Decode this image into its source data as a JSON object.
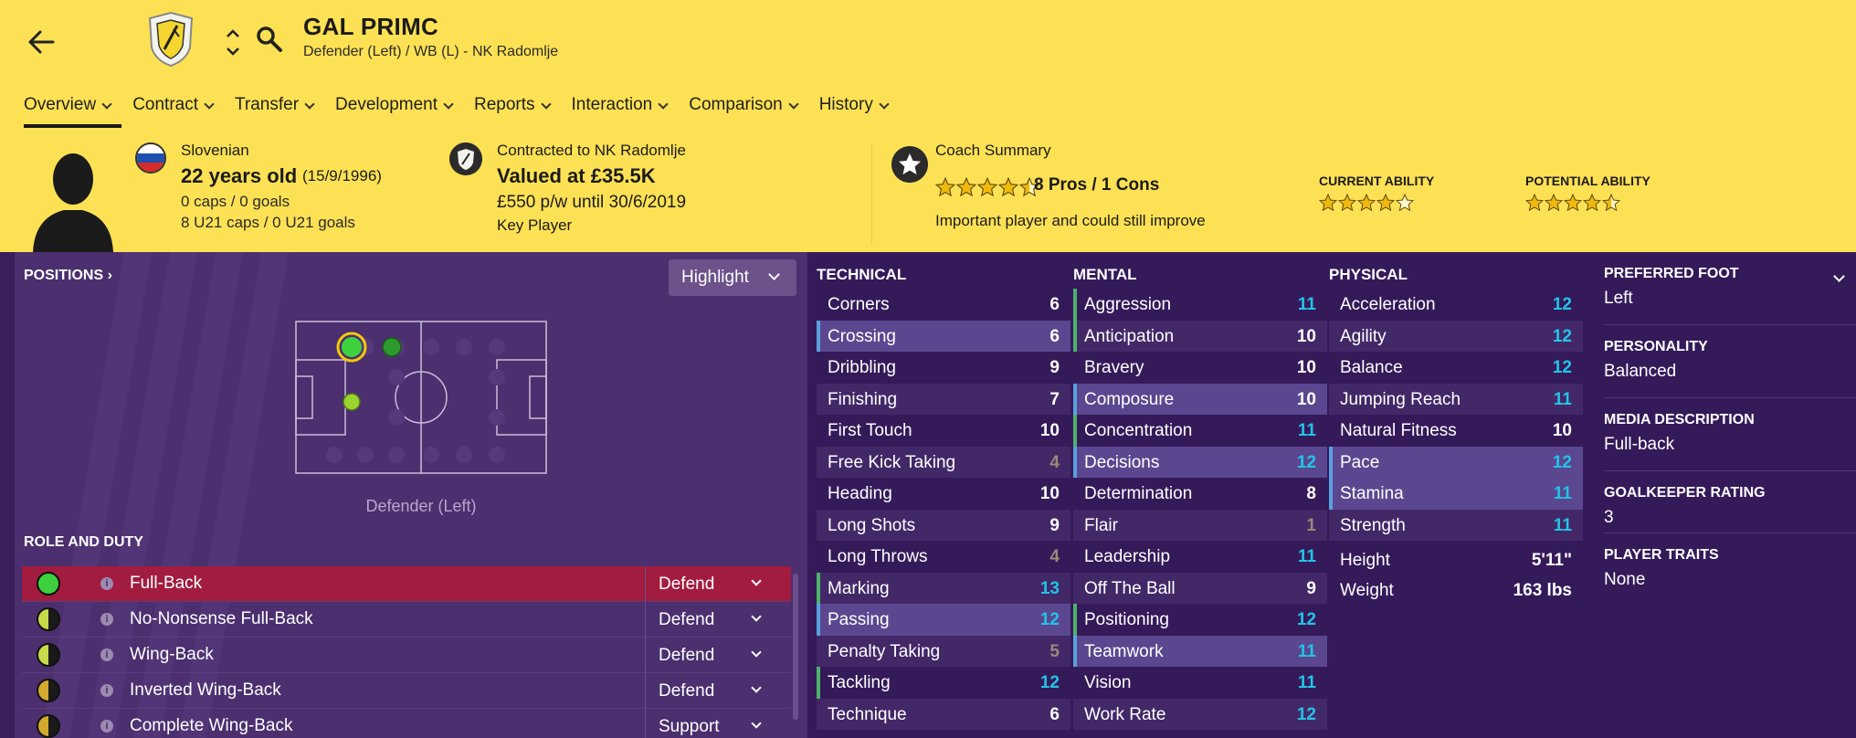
{
  "header": {
    "name": "GAL PRIMC",
    "subtitle": "Defender (Left) / WB (L) - NK Radomlje"
  },
  "tabs": [
    {
      "label": "Overview"
    },
    {
      "label": "Contract"
    },
    {
      "label": "Transfer"
    },
    {
      "label": "Development"
    },
    {
      "label": "Reports"
    },
    {
      "label": "Interaction"
    },
    {
      "label": "Comparison"
    },
    {
      "label": "History"
    }
  ],
  "profile": {
    "nationality": "Slovenian",
    "age": "22 years old",
    "dob": "(15/9/1996)",
    "caps": "0 caps / 0 goals",
    "u21": "8 U21 caps / 0 U21 goals"
  },
  "contract": {
    "club_line": "Contracted to NK Radomlje",
    "value": "Valued at £35.5K",
    "wage": "£550 p/w until 30/6/2019",
    "status": "Key Player"
  },
  "coach": {
    "title": "Coach Summary",
    "pros_cons": "8 Pros / 1 Cons",
    "stars": 4.5,
    "text": "Important player and could still improve",
    "current_label": "CURRENT ABILITY",
    "current_stars": 4,
    "potential_label": "POTENTIAL ABILITY",
    "potential_stars": 4.5
  },
  "positions": {
    "title": "POSITIONS",
    "highlight_label": "Highlight",
    "pitch_label": "Defender (Left)"
  },
  "roles": {
    "title": "ROLE AND DUTY",
    "items": [
      {
        "name": "Full-Back",
        "duty": "Defend"
      },
      {
        "name": "No-Nonsense Full-Back",
        "duty": "Defend"
      },
      {
        "name": "Wing-Back",
        "duty": "Defend"
      },
      {
        "name": "Inverted Wing-Back",
        "duty": "Defend"
      },
      {
        "name": "Complete Wing-Back",
        "duty": "Support"
      }
    ]
  },
  "attributes": {
    "technical_title": "TECHNICAL",
    "technical": [
      {
        "name": "Corners",
        "value": "6"
      },
      {
        "name": "Crossing",
        "value": "6"
      },
      {
        "name": "Dribbling",
        "value": "9"
      },
      {
        "name": "Finishing",
        "value": "7"
      },
      {
        "name": "First Touch",
        "value": "10"
      },
      {
        "name": "Free Kick Taking",
        "value": "4"
      },
      {
        "name": "Heading",
        "value": "10"
      },
      {
        "name": "Long Shots",
        "value": "9"
      },
      {
        "name": "Long Throws",
        "value": "4"
      },
      {
        "name": "Marking",
        "value": "13"
      },
      {
        "name": "Passing",
        "value": "12"
      },
      {
        "name": "Penalty Taking",
        "value": "5"
      },
      {
        "name": "Tackling",
        "value": "12"
      },
      {
        "name": "Technique",
        "value": "6"
      }
    ],
    "mental_title": "MENTAL",
    "mental": [
      {
        "name": "Aggression",
        "value": "11"
      },
      {
        "name": "Anticipation",
        "value": "10"
      },
      {
        "name": "Bravery",
        "value": "10"
      },
      {
        "name": "Composure",
        "value": "10"
      },
      {
        "name": "Concentration",
        "value": "11"
      },
      {
        "name": "Decisions",
        "value": "12"
      },
      {
        "name": "Determination",
        "value": "8"
      },
      {
        "name": "Flair",
        "value": "1"
      },
      {
        "name": "Leadership",
        "value": "11"
      },
      {
        "name": "Off The Ball",
        "value": "9"
      },
      {
        "name": "Positioning",
        "value": "12"
      },
      {
        "name": "Teamwork",
        "value": "11"
      },
      {
        "name": "Vision",
        "value": "11"
      },
      {
        "name": "Work Rate",
        "value": "12"
      }
    ],
    "physical_title": "PHYSICAL",
    "physical": [
      {
        "name": "Acceleration",
        "value": "12"
      },
      {
        "name": "Agility",
        "value": "12"
      },
      {
        "name": "Balance",
        "value": "12"
      },
      {
        "name": "Jumping Reach",
        "value": "11"
      },
      {
        "name": "Natural Fitness",
        "value": "10"
      },
      {
        "name": "Pace",
        "value": "12"
      },
      {
        "name": "Stamina",
        "value": "11"
      },
      {
        "name": "Strength",
        "value": "11"
      }
    ],
    "height_label": "Height",
    "height": "5'11\"",
    "weight_label": "Weight",
    "weight": "163 lbs"
  },
  "info": {
    "foot_label": "PREFERRED FOOT",
    "foot": "Left",
    "personality_label": "PERSONALITY",
    "personality": "Balanced",
    "media_label": "MEDIA DESCRIPTION",
    "media": "Full-back",
    "gk_label": "GOALKEEPER RATING",
    "gk": "3",
    "traits_label": "PLAYER TRAITS",
    "traits": "None"
  },
  "colors": {
    "header_bg": "#fde154",
    "panel_bg": "#351a5a",
    "selected_role": "#a21c40",
    "value_cyan": "#22c4e8"
  }
}
